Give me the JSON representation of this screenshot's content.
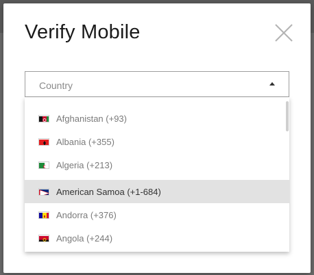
{
  "dialog": {
    "title": "Verify Mobile",
    "close_icon": "close-icon"
  },
  "country_select": {
    "placeholder": "Country",
    "caret_icon": "caret-up-icon",
    "options": [
      {
        "label": "Afghanistan (+93)",
        "flag": "flag-af-icon",
        "selected": false
      },
      {
        "label": "Albania (+355)",
        "flag": "flag-al-icon",
        "selected": false
      },
      {
        "label": "Algeria (+213)",
        "flag": "flag-dz-icon",
        "selected": false
      },
      {
        "label": "American Samoa (+1-684)",
        "flag": "flag-as-icon",
        "selected": true
      },
      {
        "label": "Andorra (+376)",
        "flag": "flag-ad-icon",
        "selected": false
      },
      {
        "label": "Angola (+244)",
        "flag": "flag-ao-icon",
        "selected": false
      }
    ]
  },
  "colors": {
    "selected_row_bg": "#e2e2e2",
    "option_text": "#7a7a7a",
    "backdrop": "#6a6a6a"
  }
}
